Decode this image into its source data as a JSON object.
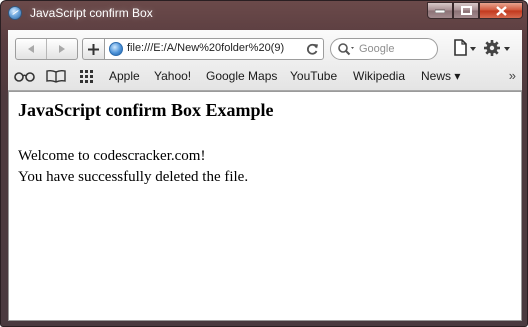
{
  "window": {
    "title": "JavaScript confirm Box"
  },
  "toolbar": {
    "url": "file:///E:/A/New%20folder%20(9)",
    "search_placeholder": "Google"
  },
  "bookmarks": {
    "items": [
      "Apple",
      "Yahoo!",
      "Google Maps",
      "YouTube",
      "Wikipedia"
    ],
    "news_label": "News ▾",
    "overflow": "»"
  },
  "page": {
    "heading": "JavaScript confirm Box Example",
    "lines": [
      "Welcome to codescracker.com!",
      "You have successfully deleted the file."
    ]
  },
  "icons": {
    "app": "safari-globe-icon",
    "back": "back-arrow-icon",
    "forward": "forward-arrow-icon",
    "add": "plus-icon",
    "reload": "reload-icon",
    "search": "magnifier-icon",
    "page_menu": "page-menu-icon",
    "settings": "gear-icon",
    "reading_list": "glasses-icon",
    "bookmarks": "book-icon",
    "top_sites": "grid-icon"
  }
}
